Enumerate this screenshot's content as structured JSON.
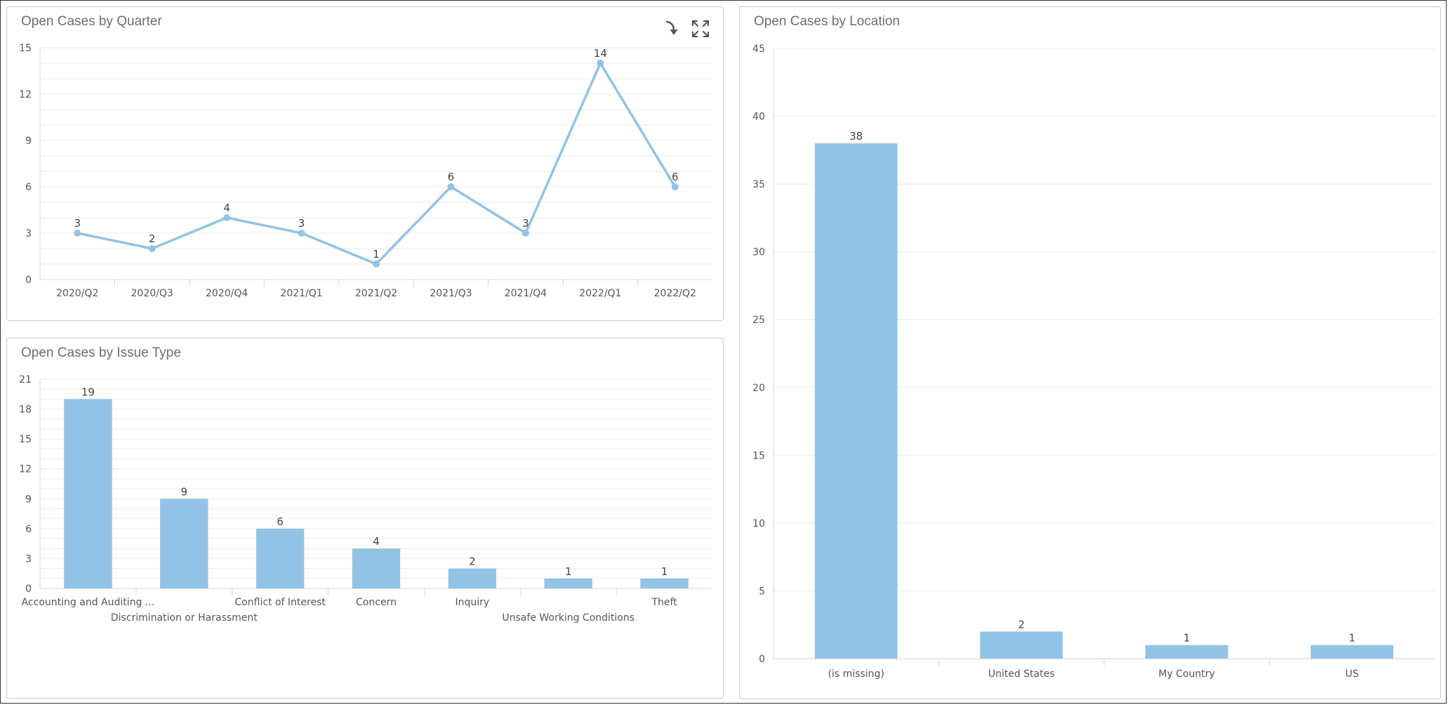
{
  "toolbar": {
    "drill_icon": "drill-down-arrow-icon",
    "expand_icon": "expand-fullscreen-icon"
  },
  "colors": {
    "series": "#93c3e4",
    "grid": "#ebebeb",
    "axis_text": "#555555",
    "title": "#6d6d6d"
  },
  "chart_data": [
    {
      "type": "line",
      "title": "Open Cases by Quarter",
      "categories": [
        "2020/Q2",
        "2020/Q3",
        "2020/Q4",
        "2021/Q1",
        "2021/Q2",
        "2021/Q3",
        "2021/Q4",
        "2022/Q1",
        "2022/Q2"
      ],
      "values": [
        3,
        2,
        4,
        3,
        1,
        6,
        3,
        14,
        6
      ],
      "ylim": [
        0,
        15
      ],
      "yticks": [
        0,
        3,
        6,
        9,
        12,
        15
      ],
      "grid": true,
      "data_labels": true
    },
    {
      "type": "bar",
      "title": "Open Cases by Issue Type",
      "categories": [
        "Accounting and Auditing ...",
        "Discrimination or Harassment",
        "Conflict of Interest",
        "Concern",
        "Inquiry",
        "Unsafe Working Conditions",
        "Theft"
      ],
      "values": [
        19,
        9,
        6,
        4,
        2,
        1,
        1
      ],
      "ylim": [
        0,
        21
      ],
      "yticks": [
        0,
        3,
        6,
        9,
        12,
        15,
        18,
        21
      ],
      "grid": true,
      "data_labels": true
    },
    {
      "type": "bar",
      "title": "Open Cases by Location",
      "categories": [
        "(is missing)",
        "United States",
        "My Country",
        "US"
      ],
      "values": [
        38,
        2,
        1,
        1
      ],
      "ylim": [
        0,
        45
      ],
      "yticks": [
        0,
        5,
        10,
        15,
        20,
        25,
        30,
        35,
        40,
        45
      ],
      "grid": true,
      "data_labels": true
    }
  ]
}
